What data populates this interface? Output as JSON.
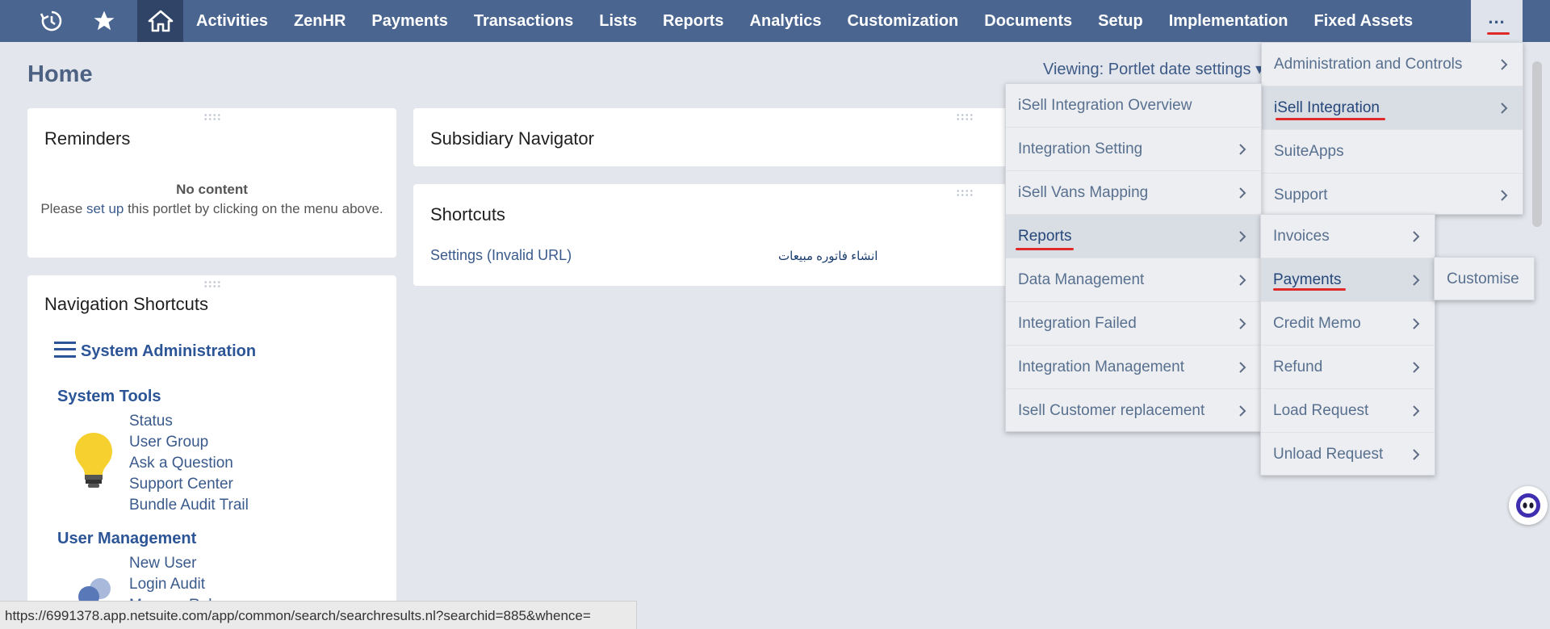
{
  "nav": {
    "items": [
      "Activities",
      "ZenHR",
      "Payments",
      "Transactions",
      "Lists",
      "Reports",
      "Analytics",
      "Customization",
      "Documents",
      "Setup",
      "Implementation",
      "Fixed Assets"
    ],
    "more_label": "..."
  },
  "page": {
    "title": "Home",
    "viewing": "Viewing: Portlet date settings ▾"
  },
  "reminders": {
    "title": "Reminders",
    "no_content": "No content",
    "please": "Please ",
    "setup_link": "set up",
    "rest": " this portlet by clicking on the menu above."
  },
  "subsidiary": {
    "title": "Subsidiary Navigator"
  },
  "shortcuts": {
    "title": "Shortcuts",
    "items": [
      "Settings (Invalid URL)",
      "انشاء فاتوره مبيعات"
    ]
  },
  "navshortcuts": {
    "title": "Navigation Shortcuts",
    "header": "System Administration",
    "sections": [
      {
        "title": "System Tools",
        "links": [
          "Status",
          "User Group",
          "Ask a Question",
          "Support Center",
          "Bundle Audit Trail"
        ]
      },
      {
        "title": "User Management",
        "links": [
          "New User",
          "Login Audit",
          "Manage Roles"
        ]
      }
    ]
  },
  "menus": {
    "more": [
      "Administration and Controls",
      "iSell Integration",
      "SuiteApps",
      "Support"
    ],
    "isell": [
      "iSell Integration Overview",
      "Integration Setting",
      "iSell Vans Mapping",
      "Reports",
      "Data Management",
      "Integration Failed",
      "Integration Management",
      "Isell Customer replacement"
    ],
    "reports": [
      "Invoices",
      "Payments",
      "Credit Memo",
      "Refund",
      "Load Request",
      "Unload Request"
    ],
    "payments": [
      "Customise"
    ]
  },
  "status_url": "https://6991378.app.netsuite.com/app/common/search/searchresults.nl?searchid=885&whence=",
  "colors": {
    "nav_bg": "#4a6590",
    "link": "#3a5a8c",
    "annotation": "#e02a2a"
  }
}
